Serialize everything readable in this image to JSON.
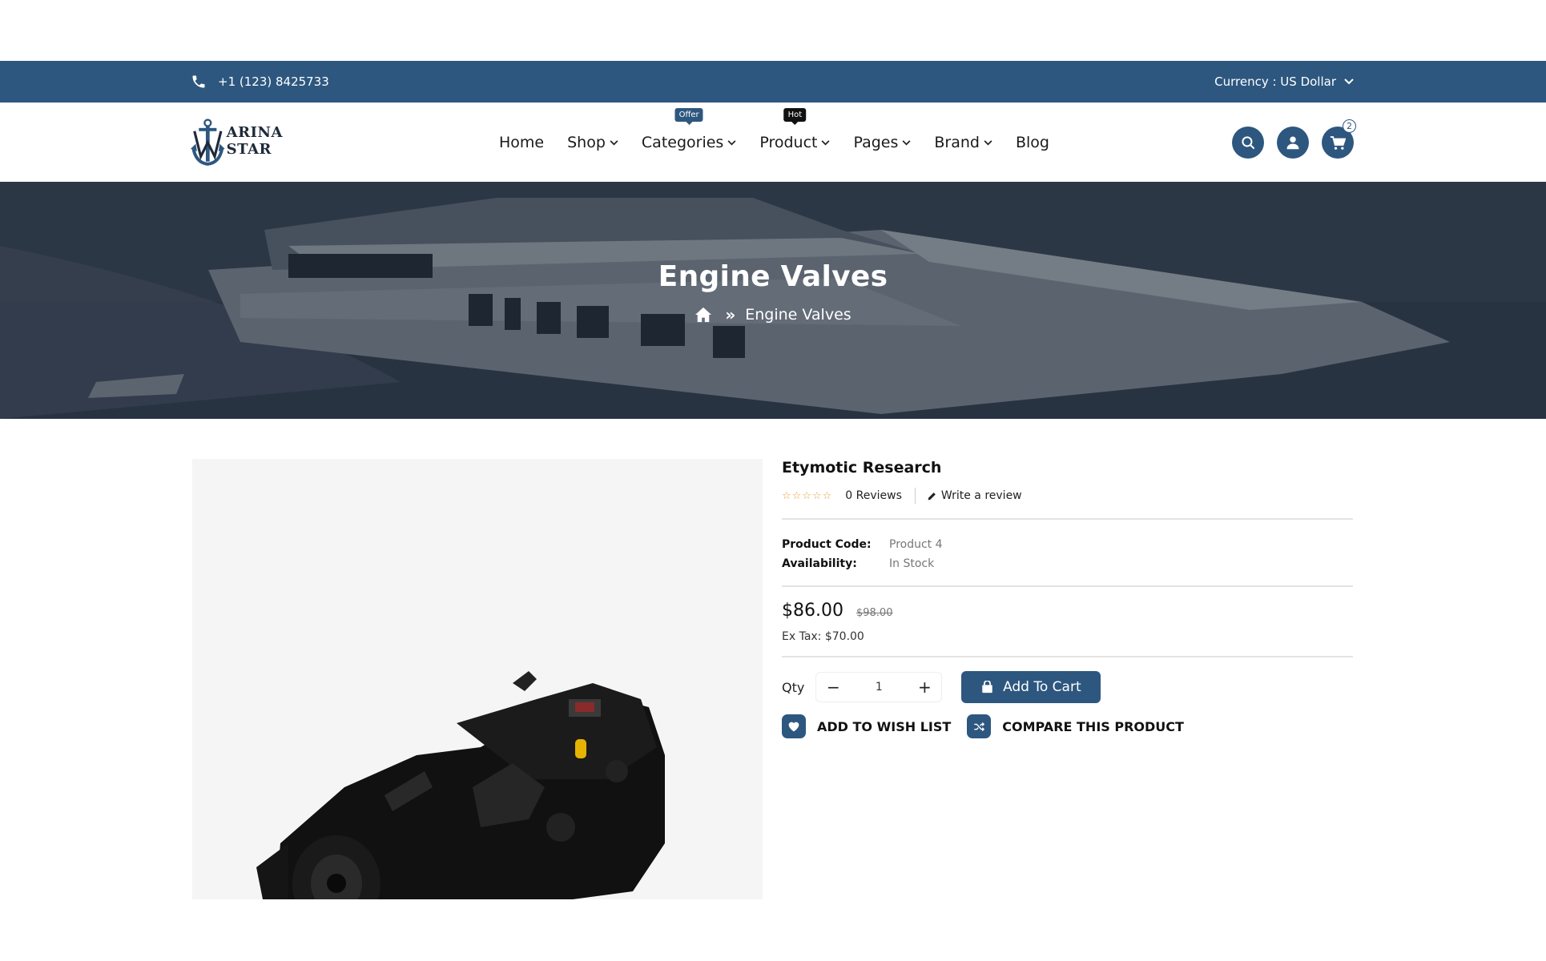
{
  "topbar": {
    "phone": "+1 (123) 8425733",
    "currency": "Currency : US Dollar"
  },
  "brand": {
    "logo_text": "ARINA STAR"
  },
  "nav": {
    "home": "Home",
    "shop": "Shop",
    "categories": "Categories",
    "categories_badge": "Offer",
    "product": "Product",
    "product_badge": "Hot",
    "pages": "Pages",
    "brand": "Brand",
    "blog": "Blog"
  },
  "header_icons": {
    "search": "search-icon",
    "account": "user-icon",
    "cart": "cart-icon",
    "cart_count": "2"
  },
  "hero": {
    "title": "Engine Valves",
    "breadcrumb_current": "Engine Valves"
  },
  "product": {
    "title": "Etymotic Research",
    "rating_stars": "☆☆☆☆☆",
    "reviews": "0 Reviews",
    "write_review": "Write a review",
    "code_label": "Product Code:",
    "code_value": "Product 4",
    "availability_label": "Availability:",
    "availability_value": "In Stock",
    "price": "$86.00",
    "old_price": "$98.00",
    "ex_tax": "Ex Tax: $70.00",
    "qty_label": "Qty",
    "qty_value": "1",
    "add_to_cart": "Add To Cart",
    "wishlist": "ADD TO WISH LIST",
    "compare": "COMPARE THIS PRODUCT"
  },
  "colors": {
    "primary": "#2d577f",
    "star": "#e9a23b"
  }
}
